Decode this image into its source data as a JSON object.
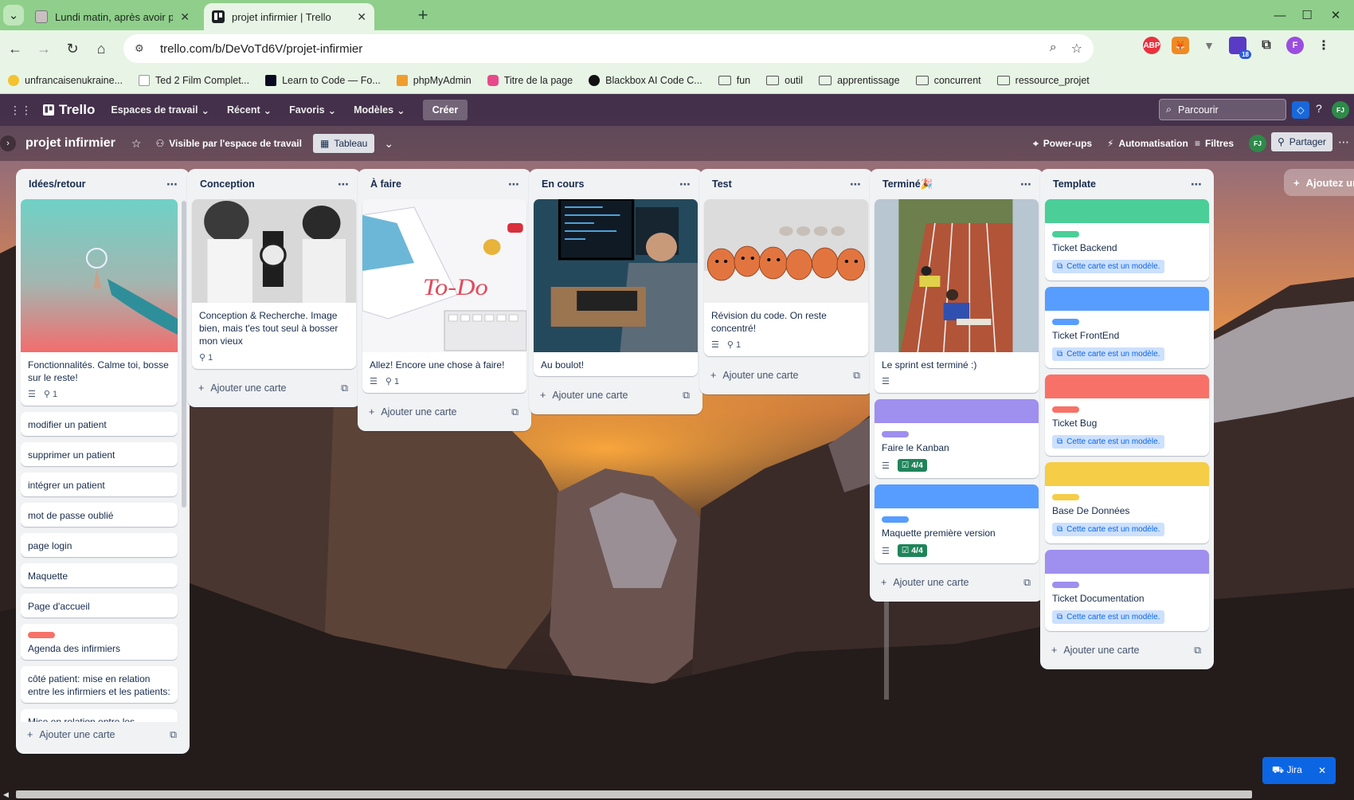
{
  "browser": {
    "tabs": [
      {
        "title": "Lundi matin, après avoir passé",
        "active": false
      },
      {
        "title": "projet infirmier | Trello",
        "active": true
      }
    ],
    "url": "trello.com/b/DeVoTd6V/projet-infirmier",
    "extension_badge": "18",
    "profile_initial": "F",
    "bookmarks": [
      {
        "label": "unfrancaisenukraine...",
        "icon": "bulb-icon"
      },
      {
        "label": "Ted 2 Film Complet...",
        "icon": "page-icon"
      },
      {
        "label": "Learn to Code — Fo...",
        "icon": "fcc-icon"
      },
      {
        "label": "phpMyAdmin",
        "icon": "pma-icon"
      },
      {
        "label": "Titre de la page",
        "icon": "pink-icon"
      },
      {
        "label": "Blackbox AI Code C...",
        "icon": "blackbox-icon"
      },
      {
        "label": "fun",
        "icon": "folder-icon"
      },
      {
        "label": "outil",
        "icon": "folder-icon"
      },
      {
        "label": "apprentissage",
        "icon": "folder-icon"
      },
      {
        "label": "concurrent",
        "icon": "folder-icon"
      },
      {
        "label": "ressource_projet",
        "icon": "folder-icon"
      }
    ]
  },
  "trello": {
    "logo": "Trello",
    "menus": [
      "Espaces de travail",
      "Récent",
      "Favoris",
      "Modèles"
    ],
    "create": "Créer",
    "search_placeholder": "Parcourir",
    "avatar": "FJ"
  },
  "board": {
    "title": "projet infirmier",
    "visibility": "Visible par l'espace de travail",
    "view": "Tableau",
    "powerups": "Power-ups",
    "automation": "Automatisation",
    "filters": "Filtres",
    "member": "FJ",
    "share": "Partager",
    "add_list": "Ajoutez une",
    "add_card": "Ajouter une carte",
    "template_badge": "Cette carte est un modèle."
  },
  "lists": [
    {
      "title": "Idées/retour",
      "cards": [
        {
          "title": "Fonctionnalités. Calme toi, bosse sur le reste!",
          "cover": "bulb",
          "desc": true,
          "attach": "1"
        },
        {
          "title": "modifier un patient"
        },
        {
          "title": "supprimer un patient"
        },
        {
          "title": "intégrer un patient"
        },
        {
          "title": "mot de passe oublié"
        },
        {
          "title": "page login"
        },
        {
          "title": "Maquette"
        },
        {
          "title": "Page d'accueil"
        },
        {
          "title": "Agenda des infirmiers",
          "label_color": "#f87168"
        },
        {
          "title": "côté patient: mise en relation entre les infirmiers et les patients:"
        },
        {
          "title": "Mise en relation entre les cabinets infirmiers et les infirmiers. Le cabinet partage un texte (salaire/fréquence) et demande un"
        }
      ]
    },
    {
      "title": "Conception",
      "cards": [
        {
          "title": "Conception & Recherche. Image bien, mais t'es tout seul à bosser mon vieux",
          "cover": "lab",
          "attach": "1"
        }
      ]
    },
    {
      "title": "À faire",
      "cards": [
        {
          "title": "Allez! Encore une chose à faire!",
          "cover": "todo",
          "desc": true,
          "attach": "1"
        }
      ]
    },
    {
      "title": "En cours",
      "cards": [
        {
          "title": "Au boulot!",
          "cover": "coder"
        }
      ]
    },
    {
      "title": "Test",
      "cards": [
        {
          "title": "Révision du code. On reste concentré!",
          "cover": "eggs",
          "desc": true,
          "attach": "1"
        }
      ]
    },
    {
      "title": "Terminé🎉",
      "cards": [
        {
          "title": "Le sprint est terminé :)",
          "cover": "track",
          "desc": true
        },
        {
          "title": "Faire le Kanban",
          "cover_color": "#9f8fef",
          "label_color": "#9f8fef",
          "desc": true,
          "check": "4/4"
        },
        {
          "title": "Maquette première version",
          "cover_color": "#579dff",
          "label_color": "#579dff",
          "desc": true,
          "check": "4/4"
        }
      ]
    },
    {
      "title": "Template",
      "cards": [
        {
          "title": "Ticket Backend",
          "cover_color": "#4bce97",
          "label_color": "#4bce97",
          "template": true
        },
        {
          "title": "Ticket FrontEnd",
          "cover_color": "#579dff",
          "label_color": "#579dff",
          "template": true
        },
        {
          "title": "Ticket Bug",
          "cover_color": "#f87168",
          "label_color": "#f87168",
          "template": true
        },
        {
          "title": "Base De Données",
          "cover_color": "#f5cd47",
          "label_color": "#f5cd47",
          "template": true
        },
        {
          "title": "Ticket Documentation",
          "cover_color": "#9f8fef",
          "label_color": "#9f8fef",
          "template": true
        }
      ]
    }
  ],
  "jira": {
    "label": "Jira"
  }
}
